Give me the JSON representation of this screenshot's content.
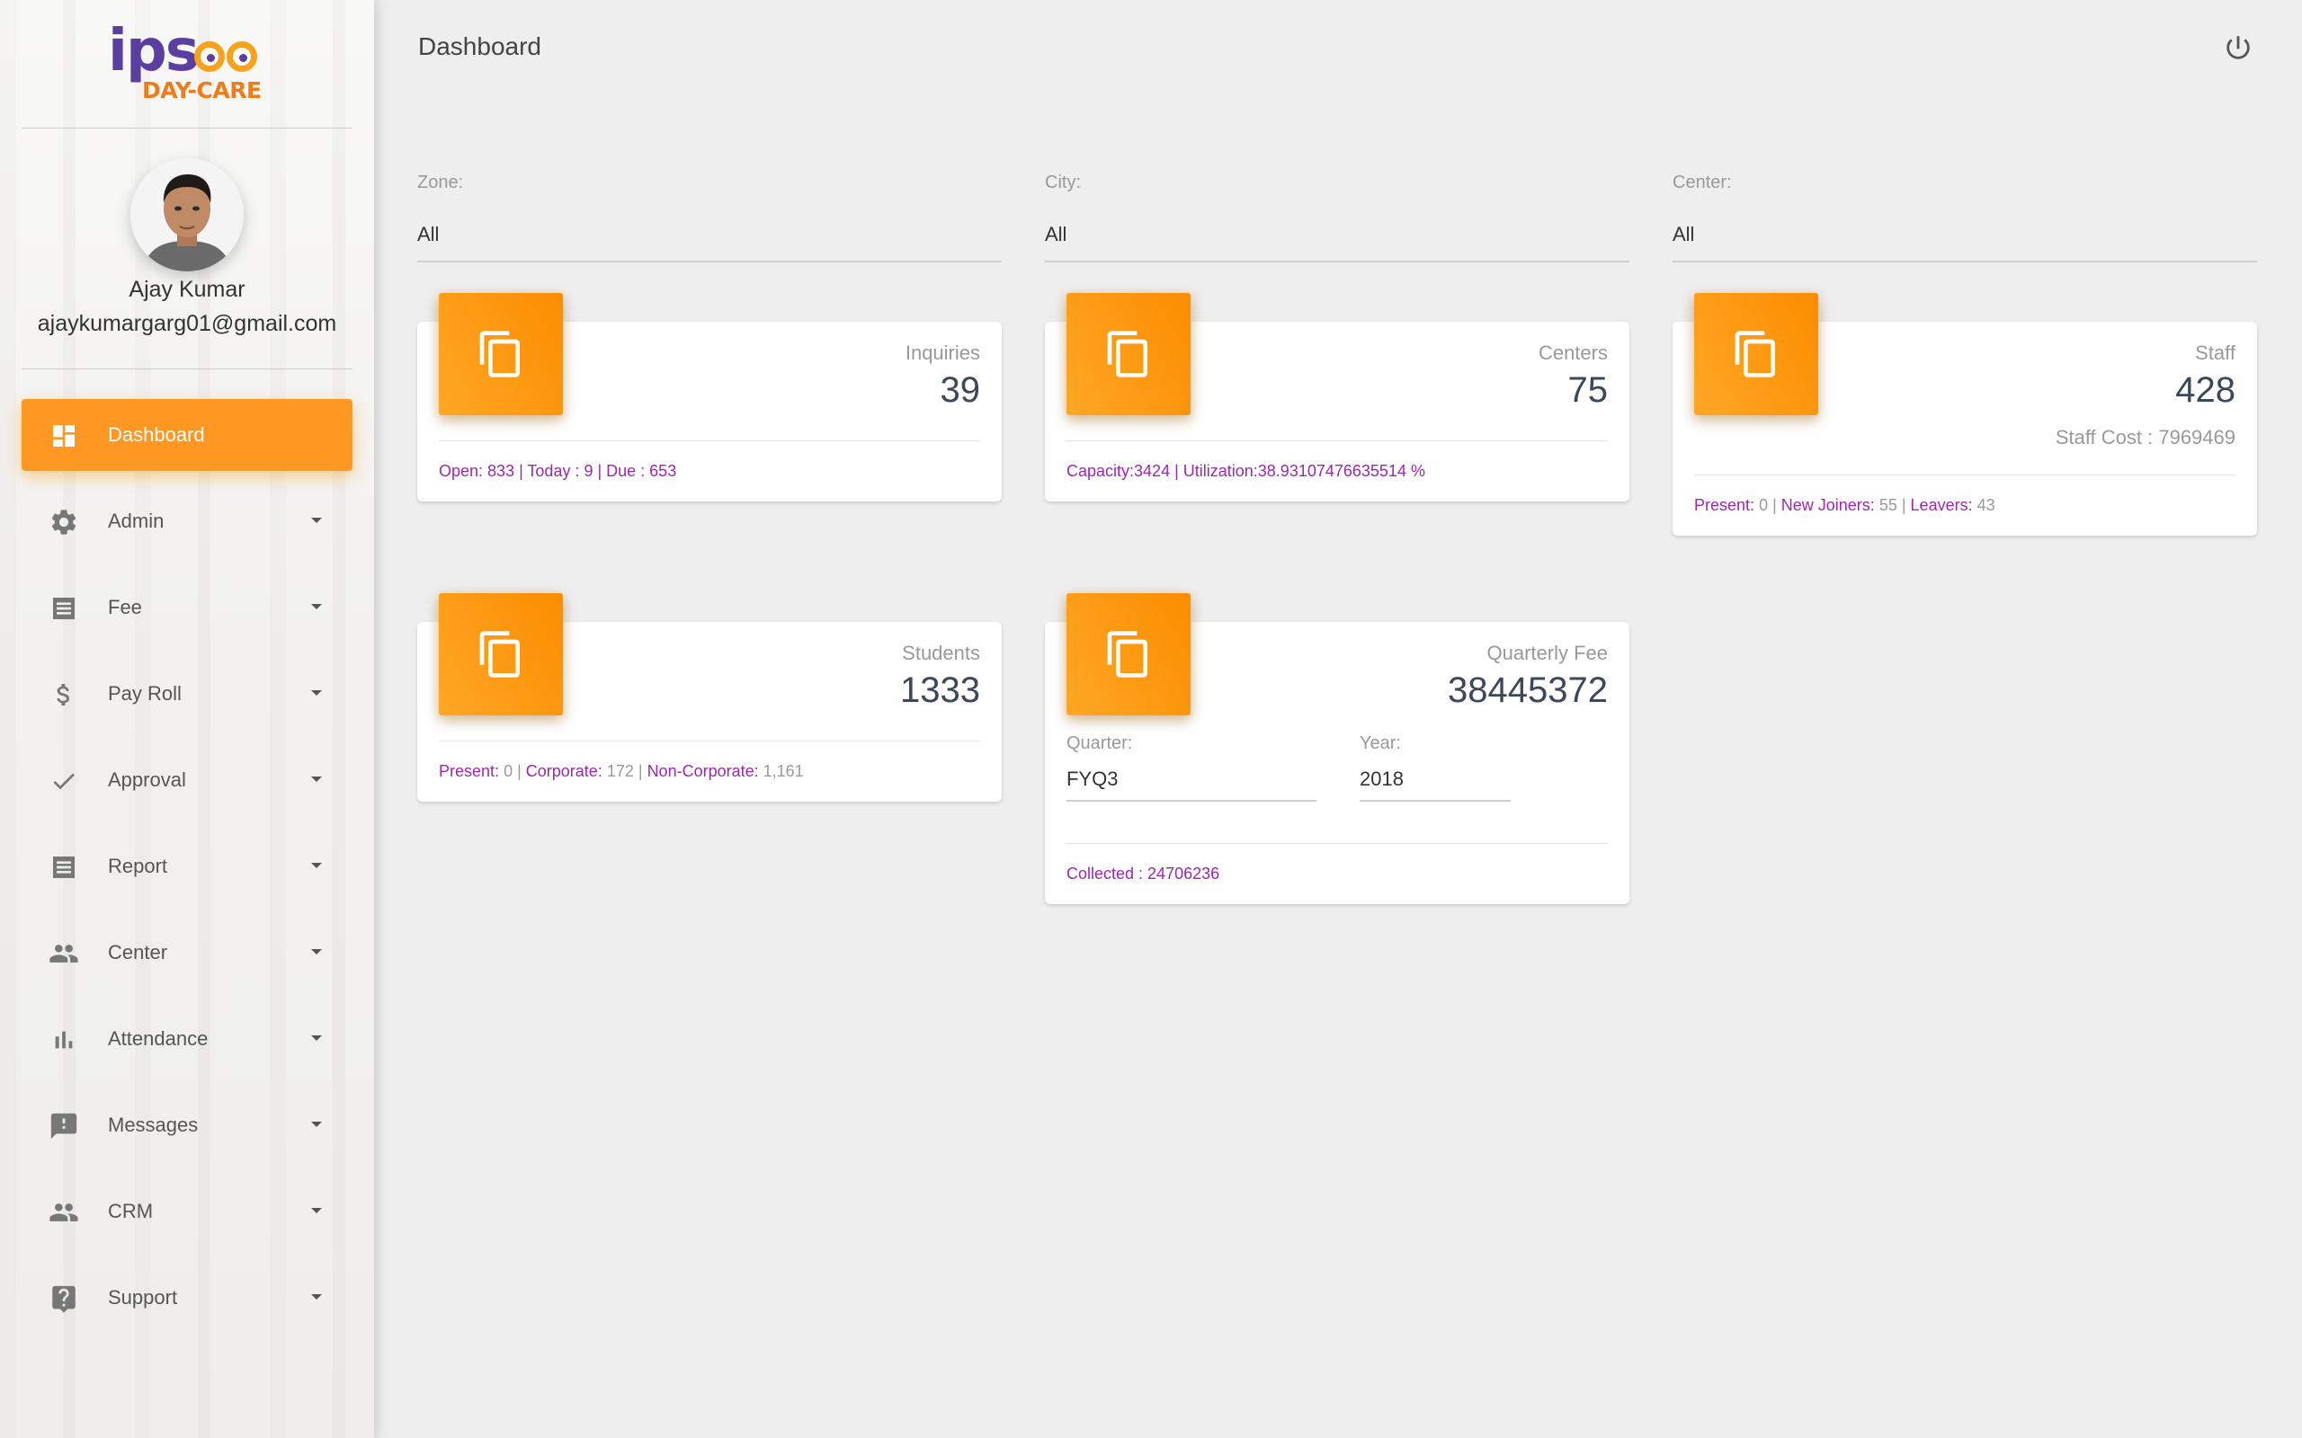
{
  "brand": {
    "logo_main": "ips",
    "logo_sub": "DAY-CARE"
  },
  "user": {
    "name": "Ajay Kumar",
    "email": "ajaykumargarg01@gmail.com"
  },
  "sidebar": {
    "items": [
      {
        "label": "Dashboard",
        "icon": "dashboard-icon",
        "active": true
      },
      {
        "label": "Admin",
        "icon": "gear-icon"
      },
      {
        "label": "Fee",
        "icon": "receipt-icon"
      },
      {
        "label": "Pay Roll",
        "icon": "dollar-icon"
      },
      {
        "label": "Approval",
        "icon": "check-icon"
      },
      {
        "label": "Report",
        "icon": "report-icon"
      },
      {
        "label": "Center",
        "icon": "people-icon"
      },
      {
        "label": "Attendance",
        "icon": "bar-chart-icon"
      },
      {
        "label": "Messages",
        "icon": "message-alert-icon"
      },
      {
        "label": "CRM",
        "icon": "people-icon"
      },
      {
        "label": "Support",
        "icon": "help-icon"
      }
    ]
  },
  "header": {
    "title": "Dashboard",
    "power_icon": "power-icon"
  },
  "filters": {
    "zone": {
      "label": "Zone:",
      "value": "All"
    },
    "city": {
      "label": "City:",
      "value": "All"
    },
    "center": {
      "label": "Center:",
      "value": "All"
    }
  },
  "cards": {
    "inquiries": {
      "title": "Inquiries",
      "value": "39",
      "footer": "Open: 833 | Today : 9 | Due : 653"
    },
    "centers": {
      "title": "Centers",
      "value": "75",
      "footer": "Capacity:3424 | Utilization:38.93107476635514 %"
    },
    "staff": {
      "title": "Staff",
      "value": "428",
      "cost": "Staff Cost : 7969469",
      "present_label": "Present:",
      "present_value": "0",
      "joiners_label": "New Joiners:",
      "joiners_value": "55",
      "leavers_label": "Leavers:",
      "leavers_value": "43"
    },
    "students": {
      "title": "Students",
      "value": "1333",
      "present_label": "Present:",
      "present_value": "0",
      "corporate_label": "Corporate:",
      "corporate_value": "172",
      "noncorporate_label": "Non-Corporate:",
      "noncorporate_value": "1,161"
    },
    "quarterly_fee": {
      "title": "Quarterly Fee",
      "value": "38445372",
      "quarter_label": "Quarter:",
      "quarter_value": "FYQ3",
      "year_label": "Year:",
      "year_value": "2018",
      "footer": "Collected : 24706236"
    }
  },
  "colors": {
    "accent": "#ff9822",
    "footer_text": "#9c27b0",
    "background": "#eeeeee"
  }
}
